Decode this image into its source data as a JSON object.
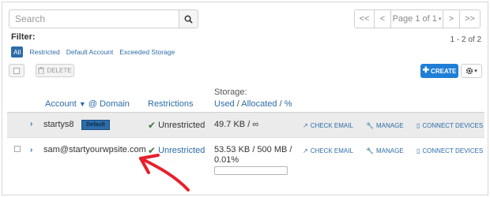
{
  "search": {
    "placeholder": "Search"
  },
  "pagination": {
    "first": "<<",
    "prev": "<",
    "page_label": "Page 1 of 1",
    "next": ">",
    "last": ">>"
  },
  "filter": {
    "title": "Filter:",
    "count": "1 - 2 of 2",
    "options": [
      "All",
      "Restricted",
      "Default Account",
      "Exceeded Storage"
    ],
    "active": "All"
  },
  "toolbar": {
    "delete_label": "DELETE",
    "create_label": "CREATE"
  },
  "table": {
    "headers": {
      "account": "Account",
      "domain": "@ Domain",
      "restrictions": "Restrictions",
      "storage_title": "Storage:",
      "storage_used": "Used",
      "storage_allocated": "Allocated",
      "storage_percent": "%"
    },
    "rows": [
      {
        "account": "startys8",
        "badge": "Default",
        "restriction": "Unrestricted",
        "storage": "49.7 KB / ∞",
        "actions": [
          "CHECK EMAIL",
          "MANAGE",
          "CONNECT DEVICES"
        ]
      },
      {
        "account": "sam@startyourwpsite.com",
        "restriction": "Unrestricted",
        "storage_line1": "53.53 KB / 500 MB /",
        "storage_line2": "0.01%",
        "usage_fraction": 0.0001,
        "actions": [
          "CHECK EMAIL",
          "MANAGE",
          "CONNECT DEVICES"
        ]
      }
    ]
  },
  "colors": {
    "accent": "#2d6ca8",
    "create_button": "#1f7fd6",
    "check": "#3c763d",
    "annotation_arrow": "#e8202c"
  }
}
